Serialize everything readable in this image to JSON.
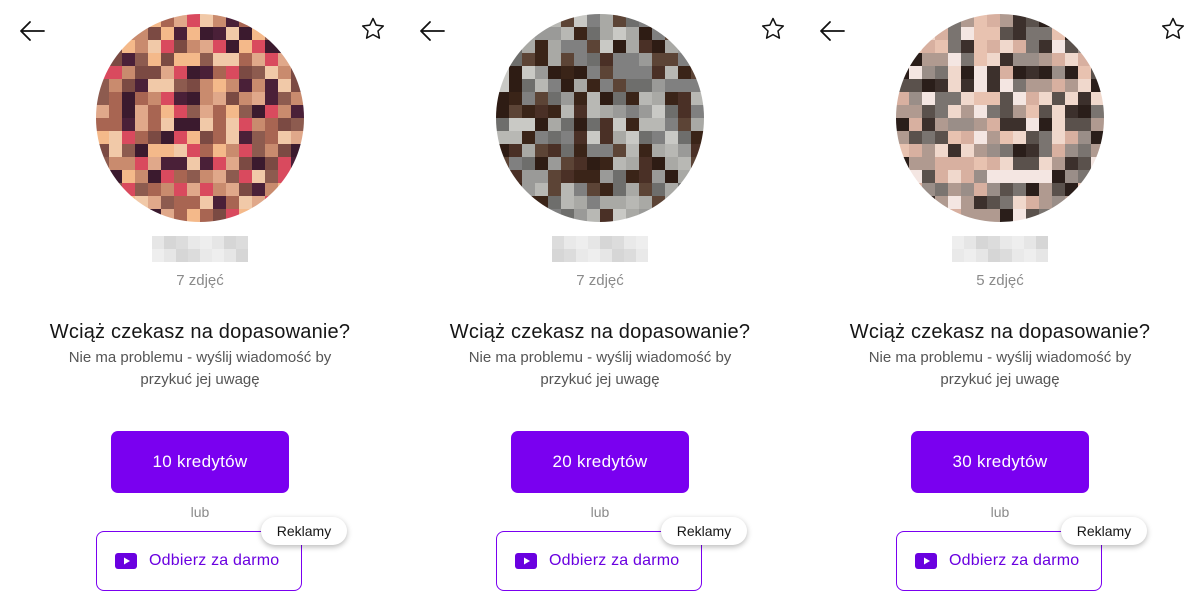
{
  "accent": "#7a00f0",
  "panels": [
    {
      "photos_count": "7 zdjęć",
      "headline": "Wciąż czekasz na dopasowanie?",
      "subtext": "Nie ma problemu - wyślij wiadomość by przykuć jej uwagę",
      "credits_button": "10 kredytów",
      "or_label": "lub",
      "free_button": "Odbierz za darmo",
      "ads_badge": "Reklamy",
      "avatar_palette": [
        "#7b4a43",
        "#a86552",
        "#4a2038",
        "#c98b6e",
        "#e0a88a",
        "#3b1a2e",
        "#d94a5e",
        "#f1c9a8",
        "#8d5b4f",
        "#f4b98a"
      ]
    },
    {
      "photos_count": "7 zdjęć",
      "headline": "Wciąż czekasz na dopasowanie?",
      "subtext": "Nie ma problemu - wyślij wiadomość by przykuć jej uwagę",
      "credits_button": "20 kredytów",
      "or_label": "lub",
      "free_button": "Odbierz za darmo",
      "ads_badge": "Reklamy",
      "avatar_palette": [
        "#9a9a98",
        "#6e6e6c",
        "#4a3026",
        "#3a2418",
        "#b8b8b4",
        "#5c4436",
        "#808080",
        "#2e1c14",
        "#a9a9a5",
        "#c9c9c5"
      ]
    },
    {
      "photos_count": "5 zdjęć",
      "headline": "Wciąż czekasz na dopasowanie?",
      "subtext": "Nie ma problemu - wyślij wiadomość by przykuć jej uwagę",
      "credits_button": "30 kredytów",
      "or_label": "lub",
      "free_button": "Odbierz za darmo",
      "ads_badge": "Reklamy",
      "avatar_palette": [
        "#7a7470",
        "#5a514c",
        "#2a1e1a",
        "#e8c2b0",
        "#f0d8cc",
        "#9a8e88",
        "#3c302c",
        "#d8b0a0",
        "#f4e6e2",
        "#b09a90"
      ]
    }
  ]
}
